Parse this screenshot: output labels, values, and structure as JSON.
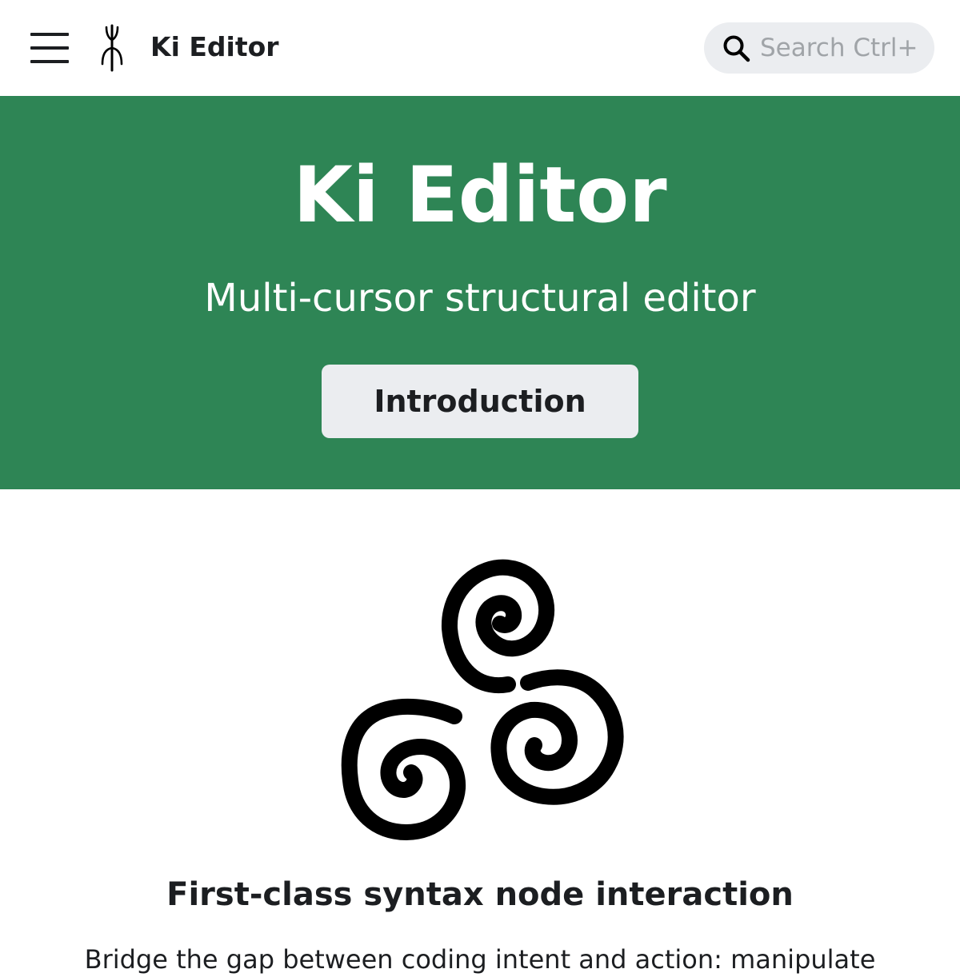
{
  "navbar": {
    "menu_icon": "hamburger-menu-icon",
    "logo_icon": "ki-logo-icon",
    "brand_title": "Ki Editor",
    "search": {
      "icon": "search-icon",
      "placeholder": "Search Ctrl+K",
      "value": ""
    }
  },
  "hero": {
    "title": "Ki Editor",
    "subtitle": "Multi-cursor structural editor",
    "button_label": "Introduction"
  },
  "feature": {
    "image_icon": "triple-spiral-icon",
    "title": "First-class syntax node interaction",
    "text": "Bridge the gap between coding intent and action: manipulate"
  },
  "colors": {
    "primary": "#2e8555",
    "button_bg": "#ebedf0",
    "text": "#1c1e21",
    "background": "#ffffff"
  }
}
